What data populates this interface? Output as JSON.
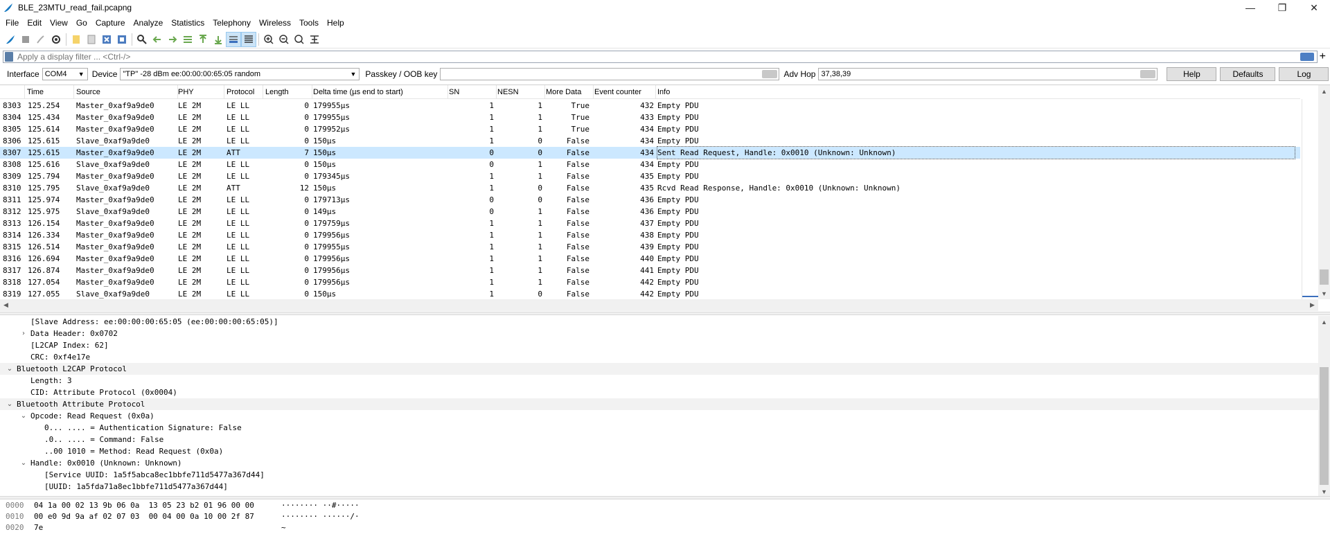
{
  "window": {
    "title": "BLE_23MTU_read_fail.pcapng",
    "controls": {
      "minimize": "—",
      "restore": "❐",
      "close": "✕"
    }
  },
  "menu": [
    "File",
    "Edit",
    "View",
    "Go",
    "Capture",
    "Analyze",
    "Statistics",
    "Telephony",
    "Wireless",
    "Tools",
    "Help"
  ],
  "toolbar_icons": [
    "shark-fin-icon",
    "stop-icon",
    "restart-icon",
    "options-icon",
    "open-icon",
    "save-icon",
    "close-file-icon",
    "reload-icon",
    "find-icon",
    "back-icon",
    "forward-icon",
    "go-to-packet-icon",
    "first-packet-icon",
    "last-packet-icon",
    "autoscroll-icon",
    "colorize-icon",
    "zoom-in-icon",
    "zoom-out-icon",
    "normal-size-icon",
    "resize-columns-icon"
  ],
  "filter": {
    "placeholder": "Apply a display filter ... <Ctrl-/>"
  },
  "sniffer": {
    "interface_label": "Interface",
    "interface_value": "COM4",
    "device_label": "Device",
    "device_value": "\"TP\"  -28 dBm  ee:00:00:00:65:05  random",
    "passkey_label": "Passkey / OOB key",
    "passkey_value": "",
    "advhop_label": "Adv Hop",
    "advhop_value": "37,38,39",
    "help_button": "Help",
    "defaults_button": "Defaults",
    "log_button": "Log"
  },
  "packet_list": {
    "columns": [
      "Time",
      "Source",
      "PHY",
      "Protocol",
      "Length",
      "Delta time (µs end to start)",
      "SN",
      "NESN",
      "More Data",
      "Event counter",
      "Info"
    ],
    "rows": [
      {
        "no": "8303",
        "time": "125.254",
        "source": "Master_0xaf9a9de0",
        "phy": "LE 2M",
        "protocol": "LE LL",
        "length": "0",
        "delta": "179955µs",
        "sn": "1",
        "nesn": "1",
        "more": "True",
        "event": "432",
        "info": "Empty PDU"
      },
      {
        "no": "8304",
        "time": "125.434",
        "source": "Master_0xaf9a9de0",
        "phy": "LE 2M",
        "protocol": "LE LL",
        "length": "0",
        "delta": "179955µs",
        "sn": "1",
        "nesn": "1",
        "more": "True",
        "event": "433",
        "info": "Empty PDU"
      },
      {
        "no": "8305",
        "time": "125.614",
        "source": "Master_0xaf9a9de0",
        "phy": "LE 2M",
        "protocol": "LE LL",
        "length": "0",
        "delta": "179952µs",
        "sn": "1",
        "nesn": "1",
        "more": "True",
        "event": "434",
        "info": "Empty PDU"
      },
      {
        "no": "8306",
        "time": "125.615",
        "source": "Slave_0xaf9a9de0",
        "phy": "LE 2M",
        "protocol": "LE LL",
        "length": "0",
        "delta": "150µs",
        "sn": "1",
        "nesn": "0",
        "more": "False",
        "event": "434",
        "info": "Empty PDU"
      },
      {
        "no": "8307",
        "time": "125.615",
        "source": "Master_0xaf9a9de0",
        "phy": "LE 2M",
        "protocol": "ATT",
        "length": "7",
        "delta": "150µs",
        "sn": "0",
        "nesn": "0",
        "more": "False",
        "event": "434",
        "info": "Sent Read Request, Handle: 0x0010 (Unknown: Unknown)",
        "selected": true
      },
      {
        "no": "8308",
        "time": "125.616",
        "source": "Slave_0xaf9a9de0",
        "phy": "LE 2M",
        "protocol": "LE LL",
        "length": "0",
        "delta": "150µs",
        "sn": "0",
        "nesn": "1",
        "more": "False",
        "event": "434",
        "info": "Empty PDU"
      },
      {
        "no": "8309",
        "time": "125.794",
        "source": "Master_0xaf9a9de0",
        "phy": "LE 2M",
        "protocol": "LE LL",
        "length": "0",
        "delta": "179345µs",
        "sn": "1",
        "nesn": "1",
        "more": "False",
        "event": "435",
        "info": "Empty PDU"
      },
      {
        "no": "8310",
        "time": "125.795",
        "source": "Slave_0xaf9a9de0",
        "phy": "LE 2M",
        "protocol": "ATT",
        "length": "12",
        "delta": "150µs",
        "sn": "1",
        "nesn": "0",
        "more": "False",
        "event": "435",
        "info": "Rcvd Read Response, Handle: 0x0010 (Unknown: Unknown)"
      },
      {
        "no": "8311",
        "time": "125.974",
        "source": "Master_0xaf9a9de0",
        "phy": "LE 2M",
        "protocol": "LE LL",
        "length": "0",
        "delta": "179713µs",
        "sn": "0",
        "nesn": "0",
        "more": "False",
        "event": "436",
        "info": "Empty PDU"
      },
      {
        "no": "8312",
        "time": "125.975",
        "source": "Slave_0xaf9a9de0",
        "phy": "LE 2M",
        "protocol": "LE LL",
        "length": "0",
        "delta": "149µs",
        "sn": "0",
        "nesn": "1",
        "more": "False",
        "event": "436",
        "info": "Empty PDU"
      },
      {
        "no": "8313",
        "time": "126.154",
        "source": "Master_0xaf9a9de0",
        "phy": "LE 2M",
        "protocol": "LE LL",
        "length": "0",
        "delta": "179759µs",
        "sn": "1",
        "nesn": "1",
        "more": "False",
        "event": "437",
        "info": "Empty PDU"
      },
      {
        "no": "8314",
        "time": "126.334",
        "source": "Master_0xaf9a9de0",
        "phy": "LE 2M",
        "protocol": "LE LL",
        "length": "0",
        "delta": "179956µs",
        "sn": "1",
        "nesn": "1",
        "more": "False",
        "event": "438",
        "info": "Empty PDU"
      },
      {
        "no": "8315",
        "time": "126.514",
        "source": "Master_0xaf9a9de0",
        "phy": "LE 2M",
        "protocol": "LE LL",
        "length": "0",
        "delta": "179955µs",
        "sn": "1",
        "nesn": "1",
        "more": "False",
        "event": "439",
        "info": "Empty PDU"
      },
      {
        "no": "8316",
        "time": "126.694",
        "source": "Master_0xaf9a9de0",
        "phy": "LE 2M",
        "protocol": "LE LL",
        "length": "0",
        "delta": "179956µs",
        "sn": "1",
        "nesn": "1",
        "more": "False",
        "event": "440",
        "info": "Empty PDU"
      },
      {
        "no": "8317",
        "time": "126.874",
        "source": "Master_0xaf9a9de0",
        "phy": "LE 2M",
        "protocol": "LE LL",
        "length": "0",
        "delta": "179956µs",
        "sn": "1",
        "nesn": "1",
        "more": "False",
        "event": "441",
        "info": "Empty PDU"
      },
      {
        "no": "8318",
        "time": "127.054",
        "source": "Master_0xaf9a9de0",
        "phy": "LE 2M",
        "protocol": "LE LL",
        "length": "0",
        "delta": "179956µs",
        "sn": "1",
        "nesn": "1",
        "more": "False",
        "event": "442",
        "info": "Empty PDU"
      },
      {
        "no": "8319",
        "time": "127.055",
        "source": "Slave_0xaf9a9de0",
        "phy": "LE 2M",
        "protocol": "LE LL",
        "length": "0",
        "delta": "150µs",
        "sn": "1",
        "nesn": "0",
        "more": "False",
        "event": "442",
        "info": "Empty PDU"
      }
    ]
  },
  "details": [
    {
      "level": 2,
      "twisty": "",
      "text": "[Slave Address: ee:00:00:00:65:05 (ee:00:00:00:65:05)]"
    },
    {
      "level": 1,
      "twisty": "›",
      "text": "Data Header: 0x0702"
    },
    {
      "level": 2,
      "twisty": "",
      "text": "[L2CAP Index: 62]"
    },
    {
      "level": 2,
      "twisty": "",
      "text": "CRC: 0xf4e17e"
    },
    {
      "level": 0,
      "twisty": "⌄",
      "text": "Bluetooth L2CAP Protocol",
      "section": true
    },
    {
      "level": 2,
      "twisty": "",
      "text": "Length: 3"
    },
    {
      "level": 2,
      "twisty": "",
      "text": "CID: Attribute Protocol (0x0004)"
    },
    {
      "level": 0,
      "twisty": "⌄",
      "text": "Bluetooth Attribute Protocol",
      "section": true
    },
    {
      "level": 1,
      "twisty": "⌄",
      "text": "Opcode: Read Request (0x0a)"
    },
    {
      "level": 3,
      "twisty": "",
      "text": "0... .... = Authentication Signature: False"
    },
    {
      "level": 3,
      "twisty": "",
      "text": ".0.. .... = Command: False"
    },
    {
      "level": 3,
      "twisty": "",
      "text": "..00 1010 = Method: Read Request (0x0a)"
    },
    {
      "level": 1,
      "twisty": "⌄",
      "text": "Handle: 0x0010 (Unknown: Unknown)"
    },
    {
      "level": 3,
      "twisty": "",
      "text": "[Service UUID: 1a5f5abca8ec1bbfe711d5477a367d44]"
    },
    {
      "level": 3,
      "twisty": "",
      "text": "[UUID: 1a5fda71a8ec1bbfe711d5477a367d44]"
    }
  ],
  "bytes": [
    {
      "offset": "0000",
      "hex": "04 1a 00 02 13 9b 06 0a  13 05 23 b2 01 96 00 00",
      "ascii": "········ ··#·····"
    },
    {
      "offset": "0010",
      "hex": "00 e0 9d 9a af 02 07 03  00 04 00 0a 10 00 2f 87",
      "ascii": "········ ······/·"
    },
    {
      "offset": "0020",
      "hex": "7e",
      "ascii": "~"
    }
  ],
  "colors": {
    "selected_row": "#cce8ff",
    "section_bg": "#f2f2f2"
  }
}
